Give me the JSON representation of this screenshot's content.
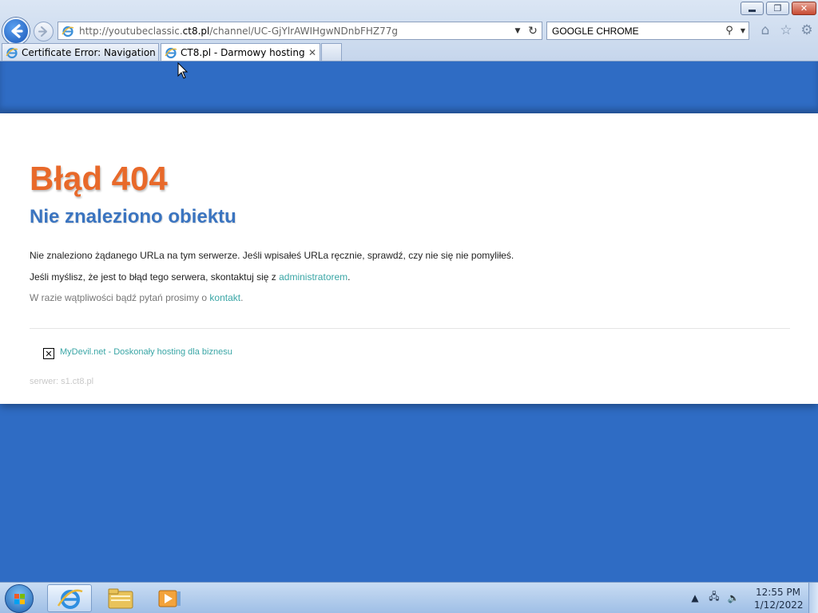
{
  "window": {
    "minimize_icon": "minimize-icon",
    "restore_icon": "restore-icon",
    "close_icon": "close-icon"
  },
  "address": {
    "url_prefix": "http://youtubeclassic.",
    "url_host": "ct8.pl",
    "url_rest": "/channel/UC-GjYlrAWIHgwNDnbFHZ77g"
  },
  "search": {
    "value": "GOOGLE CHROME"
  },
  "tabs": [
    {
      "label": "Certificate Error: Navigation Bl...",
      "active": false
    },
    {
      "label": "CT8.pl - Darmowy hosting ...",
      "active": true
    }
  ],
  "page": {
    "title": "Błąd 404",
    "subtitle": "Nie znaleziono obiektu",
    "p1": "Nie znaleziono żądanego URLa na tym serwerze. Jeśli wpisałeś URLa ręcznie, sprawdź, czy nie się nie pomyliłeś.",
    "p2_prefix": "Jeśli myślisz, że jest to błąd tego serwera, skontaktuj się z ",
    "p2_link": "administratorem",
    "p2_suffix": ".",
    "p3_prefix": "W razie wątpliwości bądź pytań prosimy o ",
    "p3_link": "kontakt",
    "p3_suffix": ".",
    "ad_link": "MyDevil.net - Doskonały hosting dla biznesu",
    "server": "serwer: s1.ct8.pl"
  },
  "taskbar": {
    "time": "12:55 PM",
    "date": "1/12/2022"
  },
  "colors": {
    "page_background": "#2f6cc4",
    "error_orange": "#e8692a",
    "subtitle_blue": "#3a74c0",
    "link_teal": "#3aa6a6"
  }
}
